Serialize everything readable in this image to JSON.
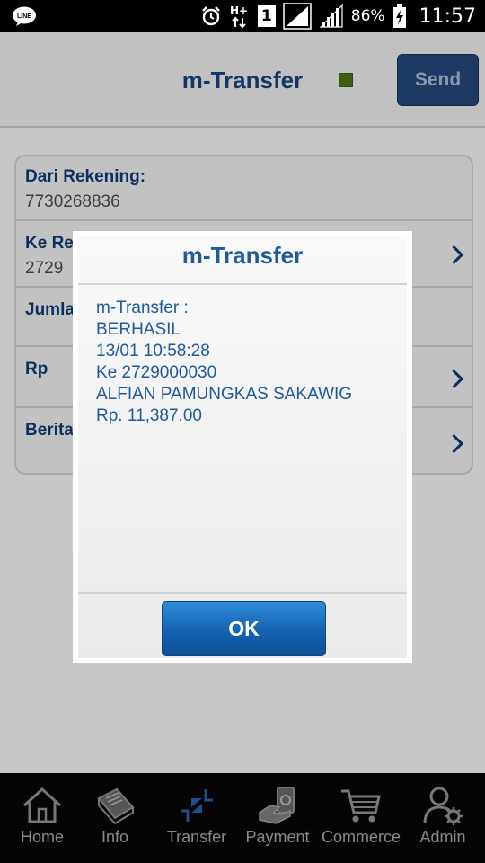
{
  "status_bar": {
    "app_icon_label": "LINE",
    "network_label": "H+",
    "sim_slot": "1",
    "battery_percent": "86%",
    "time": "11:57"
  },
  "header": {
    "title": "m-Transfer",
    "send_label": "Send"
  },
  "form": {
    "from_label": "Dari Rekening:",
    "from_value": "7730268836",
    "to_label_partial": "Ke Re",
    "to_value_partial": "2729",
    "amount_label_partial": "Jumla",
    "currency_label": "Rp",
    "message_label_partial": "Berita"
  },
  "dialog": {
    "title": "m-Transfer",
    "lines": [
      "m-Transfer :",
      "BERHASIL",
      "13/01 10:58:28",
      "Ke 2729000030",
      "ALFIAN PAMUNGKAS SAKAWIG",
      "Rp. 11,387.00"
    ],
    "ok_label": "OK"
  },
  "nav": {
    "items": [
      {
        "label": "Home",
        "icon": "home-icon"
      },
      {
        "label": "Info",
        "icon": "info-book-icon"
      },
      {
        "label": "Transfer",
        "icon": "transfer-arrows-icon"
      },
      {
        "label": "Payment",
        "icon": "payment-icon"
      },
      {
        "label": "Commerce",
        "icon": "shopping-cart-icon"
      },
      {
        "label": "Admin",
        "icon": "admin-user-gear-icon"
      }
    ],
    "active": "Transfer"
  },
  "colors": {
    "accent_blue": "#1e5a9d",
    "dark_blue": "#0e2e5e",
    "status_dot": "#4a7a16"
  }
}
